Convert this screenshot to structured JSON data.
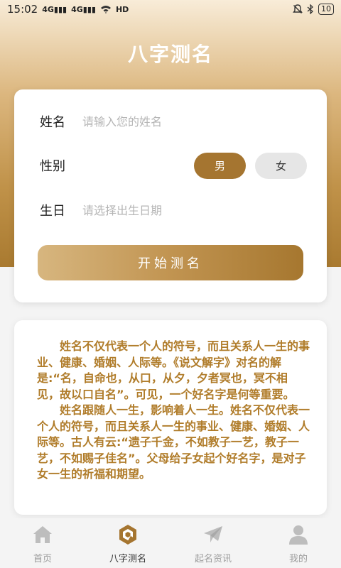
{
  "status_bar": {
    "time": "15:02",
    "signal_1": "4G",
    "signal_2": "4G",
    "hd": "HD",
    "battery": "10"
  },
  "header": {
    "title": "八字测名"
  },
  "form": {
    "name_label": "姓名",
    "name_placeholder": "请输入您的姓名",
    "gender_label": "性别",
    "gender_options": [
      "男",
      "女"
    ],
    "gender_selected": "男",
    "birthday_label": "生日",
    "birthday_placeholder": "请选择出生日期",
    "submit_label": "开始测名"
  },
  "intro": {
    "paragraphs": [
      "姓名不仅代表一个人的符号，而且关系人一生的事业、健康、婚姻、人际等。《说文解字》对名的解是:“名，自命也，从口，从夕，夕者冥也，冥不相见，故以口自名”。可见，一个好名字是何等重要。",
      "姓名跟随人一生，影响着人一生。姓名不仅代表一个人的符号，而且关系人一生的事业、健康、婚姻、人际等。古人有云:“遗子千金，不如教子一艺，教子一艺，不如赐子佳名”。父母给子女起个好名字，是对子女一生的祈福和期望。"
    ]
  },
  "tabbar": {
    "items": [
      {
        "label": "首页",
        "icon": "home-icon"
      },
      {
        "label": "八字测名",
        "icon": "bazi-logo-icon"
      },
      {
        "label": "起名资讯",
        "icon": "paper-plane-icon"
      },
      {
        "label": "我的",
        "icon": "user-icon"
      }
    ],
    "active_index": 1
  },
  "colors": {
    "accent": "#a57530",
    "intro_text": "#b07c2a",
    "tab_inactive": "#9c9c9c"
  }
}
